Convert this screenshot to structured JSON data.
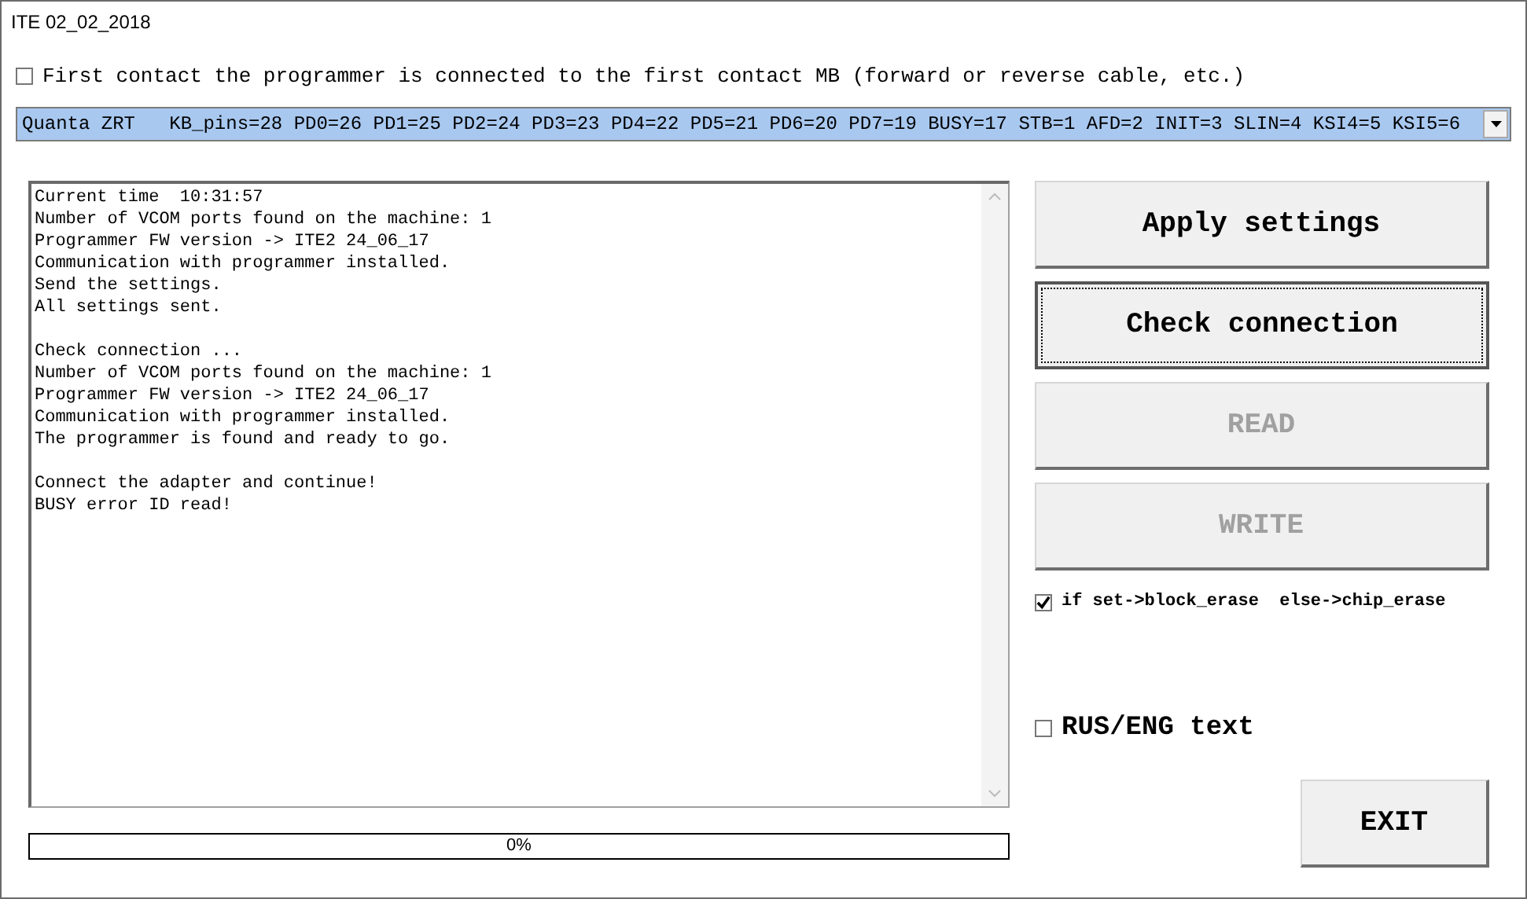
{
  "window": {
    "title": "ITE 02_02_2018"
  },
  "cable_option": {
    "label": "First contact the programmer is connected to the first contact MB (forward or reverse cable, etc.)",
    "checked": false
  },
  "pinout_select": {
    "value": "Quanta ZRT   KB_pins=28 PD0=26 PD1=25 PD2=24 PD3=23 PD4=22 PD5=21 PD6=20 PD7=19 BUSY=17 STB=1 AFD=2 INIT=3 SLIN=4 KSI4=5 KSI5=6"
  },
  "log": {
    "blocks": [
      [
        "Current time  10:31:57",
        "Number of VCOM ports found on the machine: 1",
        "Programmer FW version -> ITE2 24_06_17",
        "Communication with programmer installed.",
        "Send the settings.",
        "All settings sent."
      ],
      [
        "Check connection ...",
        "Number of VCOM ports found on the machine: 1",
        "Programmer FW version -> ITE2 24_06_17",
        "Communication with programmer installed.",
        "The programmer is found and ready to go."
      ],
      [
        "Connect the adapter and continue!",
        "BUSY error ID read!"
      ]
    ]
  },
  "buttons": [
    {
      "label": "Apply settings",
      "disabled": false,
      "focused": false
    },
    {
      "label": "Check connection",
      "disabled": false,
      "focused": true
    },
    {
      "label": "READ",
      "disabled": true,
      "focused": false
    },
    {
      "label": "WRITE",
      "disabled": true,
      "focused": false
    }
  ],
  "erase_option": {
    "label": "if set->block_erase  else->chip_erase",
    "checked": true
  },
  "language_option": {
    "label": "RUS/ENG text",
    "checked": false
  },
  "exit_button": {
    "label": "EXIT"
  },
  "progress": {
    "level": 0,
    "text": "0%"
  }
}
